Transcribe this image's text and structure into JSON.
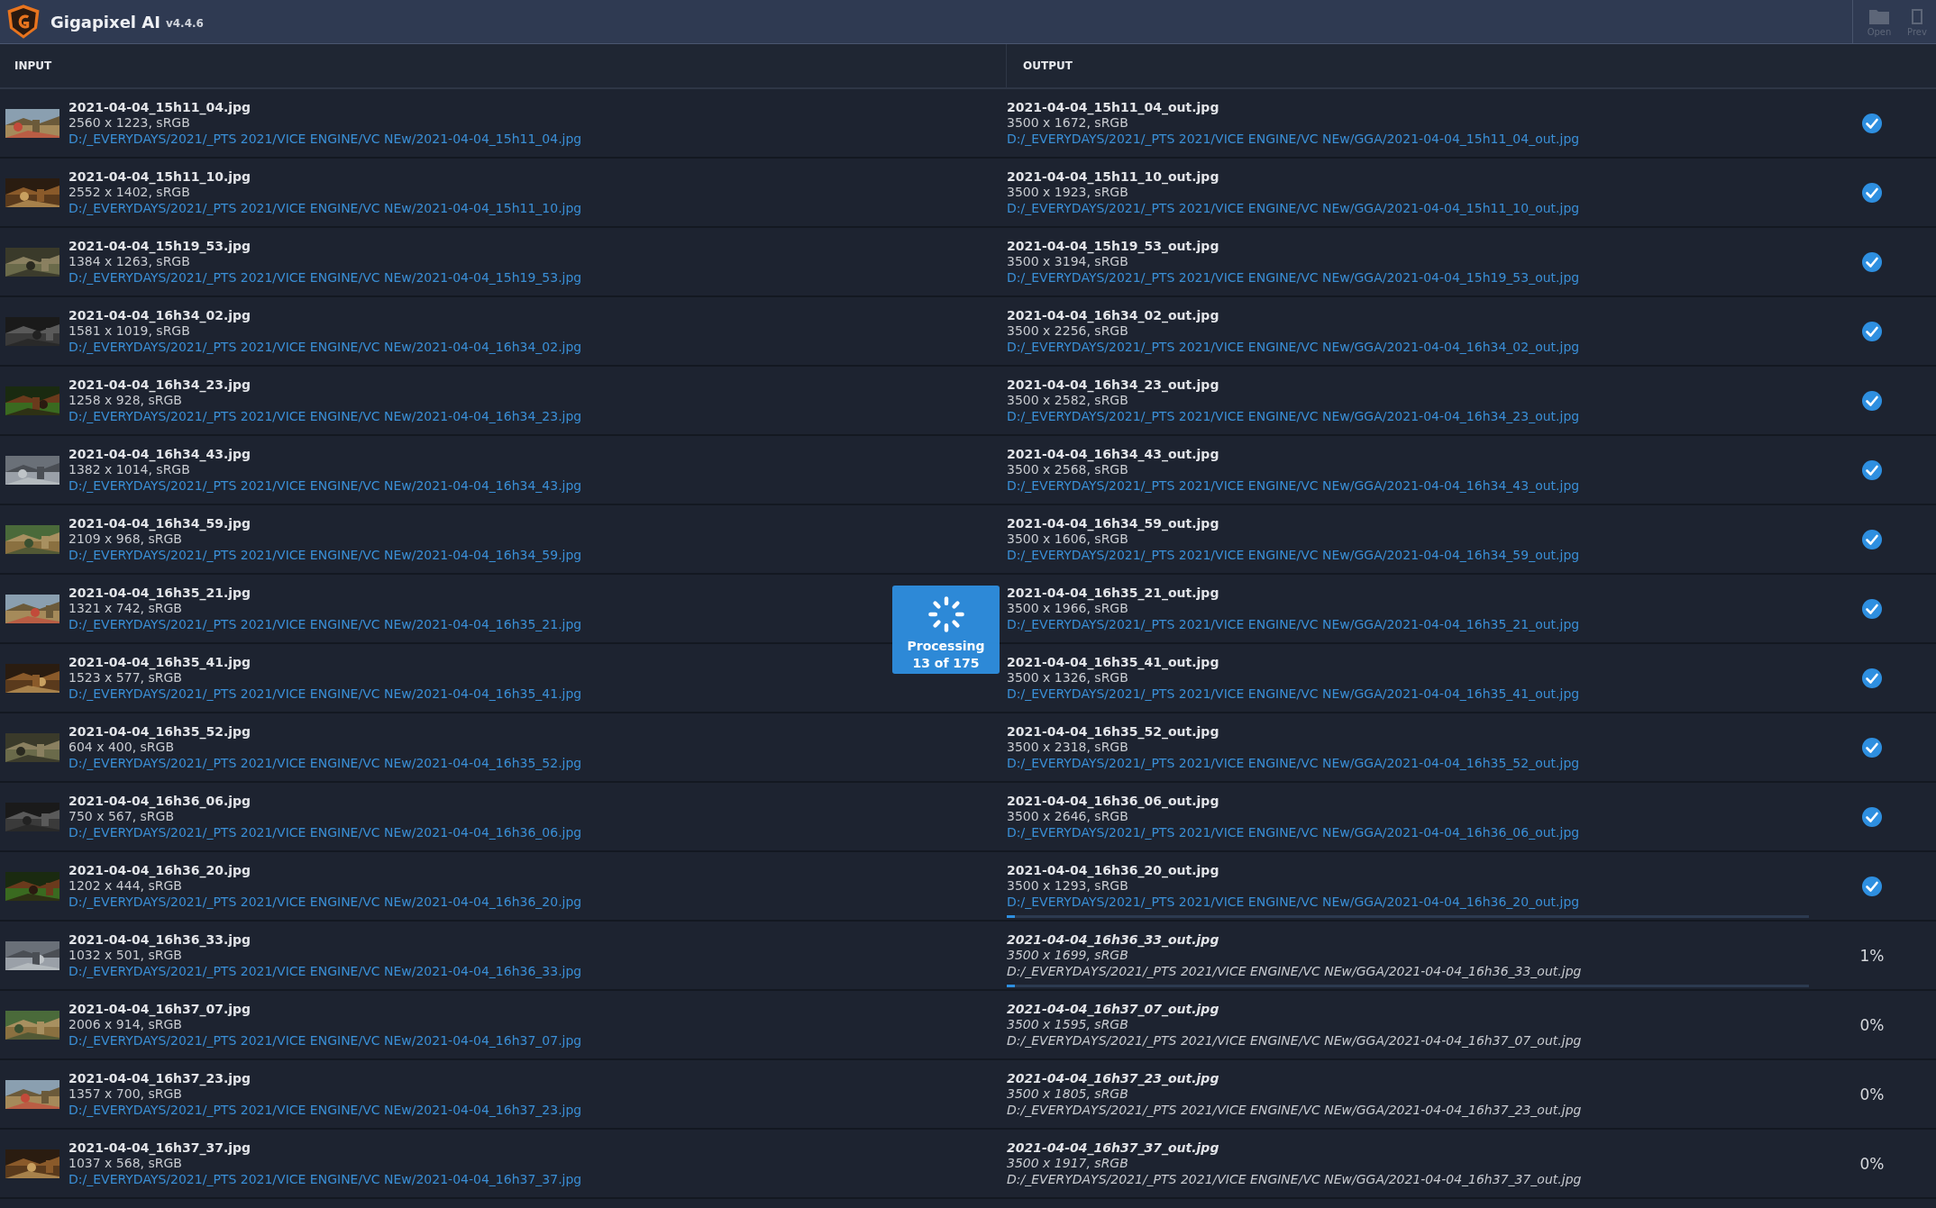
{
  "window": {
    "title": "Gigapixel AI",
    "version": "v4.4.6"
  },
  "toolbar": [
    {
      "label": "Open",
      "kind": "folder"
    },
    {
      "label": "Prev",
      "kind": "preview"
    }
  ],
  "columns": [
    "INPUT",
    "OUTPUT"
  ],
  "processing": {
    "label": "Processing",
    "count": "13 of 175"
  },
  "rows": [
    {
      "input": {
        "name": "2021-04-04_15h11_04.jpg",
        "info": "2560 x 1223, sRGB",
        "path": "D:/_EVERYDAYS/2021/_PTS 2021/VICE ENGINE/VC NEw/2021-04-04_15h11_04.jpg"
      },
      "output": {
        "name": "2021-04-04_15h11_04_out.jpg",
        "info": "3500 x 1672, sRGB",
        "path": "D:/_EVERYDAYS/2021/_PTS 2021/VICE ENGINE/VC NEw/GGA/2021-04-04_15h11_04_out.jpg"
      },
      "done": true
    },
    {
      "input": {
        "name": "2021-04-04_15h11_10.jpg",
        "info": "2552 x 1402, sRGB",
        "path": "D:/_EVERYDAYS/2021/_PTS 2021/VICE ENGINE/VC NEw/2021-04-04_15h11_10.jpg"
      },
      "output": {
        "name": "2021-04-04_15h11_10_out.jpg",
        "info": "3500 x 1923, sRGB",
        "path": "D:/_EVERYDAYS/2021/_PTS 2021/VICE ENGINE/VC NEw/GGA/2021-04-04_15h11_10_out.jpg"
      },
      "done": true
    },
    {
      "input": {
        "name": "2021-04-04_15h19_53.jpg",
        "info": "1384 x 1263, sRGB",
        "path": "D:/_EVERYDAYS/2021/_PTS 2021/VICE ENGINE/VC NEw/2021-04-04_15h19_53.jpg"
      },
      "output": {
        "name": "2021-04-04_15h19_53_out.jpg",
        "info": "3500 x 3194, sRGB",
        "path": "D:/_EVERYDAYS/2021/_PTS 2021/VICE ENGINE/VC NEw/GGA/2021-04-04_15h19_53_out.jpg"
      },
      "done": true
    },
    {
      "input": {
        "name": "2021-04-04_16h34_02.jpg",
        "info": "1581 x 1019, sRGB",
        "path": "D:/_EVERYDAYS/2021/_PTS 2021/VICE ENGINE/VC NEw/2021-04-04_16h34_02.jpg"
      },
      "output": {
        "name": "2021-04-04_16h34_02_out.jpg",
        "info": "3500 x 2256, sRGB",
        "path": "D:/_EVERYDAYS/2021/_PTS 2021/VICE ENGINE/VC NEw/GGA/2021-04-04_16h34_02_out.jpg"
      },
      "done": true
    },
    {
      "input": {
        "name": "2021-04-04_16h34_23.jpg",
        "info": "1258 x 928, sRGB",
        "path": "D:/_EVERYDAYS/2021/_PTS 2021/VICE ENGINE/VC NEw/2021-04-04_16h34_23.jpg"
      },
      "output": {
        "name": "2021-04-04_16h34_23_out.jpg",
        "info": "3500 x 2582, sRGB",
        "path": "D:/_EVERYDAYS/2021/_PTS 2021/VICE ENGINE/VC NEw/GGA/2021-04-04_16h34_23_out.jpg"
      },
      "done": true
    },
    {
      "input": {
        "name": "2021-04-04_16h34_43.jpg",
        "info": "1382 x 1014, sRGB",
        "path": "D:/_EVERYDAYS/2021/_PTS 2021/VICE ENGINE/VC NEw/2021-04-04_16h34_43.jpg"
      },
      "output": {
        "name": "2021-04-04_16h34_43_out.jpg",
        "info": "3500 x 2568, sRGB",
        "path": "D:/_EVERYDAYS/2021/_PTS 2021/VICE ENGINE/VC NEw/GGA/2021-04-04_16h34_43_out.jpg"
      },
      "done": true
    },
    {
      "input": {
        "name": "2021-04-04_16h34_59.jpg",
        "info": "2109 x 968, sRGB",
        "path": "D:/_EVERYDAYS/2021/_PTS 2021/VICE ENGINE/VC NEw/2021-04-04_16h34_59.jpg"
      },
      "output": {
        "name": "2021-04-04_16h34_59_out.jpg",
        "info": "3500 x 1606, sRGB",
        "path": "D:/_EVERYDAYS/2021/_PTS 2021/VICE ENGINE/VC NEw/GGA/2021-04-04_16h34_59_out.jpg"
      },
      "done": true
    },
    {
      "input": {
        "name": "2021-04-04_16h35_21.jpg",
        "info": "1321 x 742, sRGB",
        "path": "D:/_EVERYDAYS/2021/_PTS 2021/VICE ENGINE/VC NEw/2021-04-04_16h35_21.jpg"
      },
      "output": {
        "name": "2021-04-04_16h35_21_out.jpg",
        "info": "3500 x 1966, sRGB",
        "path": "D:/_EVERYDAYS/2021/_PTS 2021/VICE ENGINE/VC NEw/GGA/2021-04-04_16h35_21_out.jpg"
      },
      "done": true
    },
    {
      "input": {
        "name": "2021-04-04_16h35_41.jpg",
        "info": "1523 x 577, sRGB",
        "path": "D:/_EVERYDAYS/2021/_PTS 2021/VICE ENGINE/VC NEw/2021-04-04_16h35_41.jpg"
      },
      "output": {
        "name": "2021-04-04_16h35_41_out.jpg",
        "info": "3500 x 1326, sRGB",
        "path": "D:/_EVERYDAYS/2021/_PTS 2021/VICE ENGINE/VC NEw/GGA/2021-04-04_16h35_41_out.jpg"
      },
      "done": true
    },
    {
      "input": {
        "name": "2021-04-04_16h35_52.jpg",
        "info": "604 x 400, sRGB",
        "path": "D:/_EVERYDAYS/2021/_PTS 2021/VICE ENGINE/VC NEw/2021-04-04_16h35_52.jpg"
      },
      "output": {
        "name": "2021-04-04_16h35_52_out.jpg",
        "info": "3500 x 2318, sRGB",
        "path": "D:/_EVERYDAYS/2021/_PTS 2021/VICE ENGINE/VC NEw/GGA/2021-04-04_16h35_52_out.jpg"
      },
      "done": true
    },
    {
      "input": {
        "name": "2021-04-04_16h36_06.jpg",
        "info": "750 x 567, sRGB",
        "path": "D:/_EVERYDAYS/2021/_PTS 2021/VICE ENGINE/VC NEw/2021-04-04_16h36_06.jpg"
      },
      "output": {
        "name": "2021-04-04_16h36_06_out.jpg",
        "info": "3500 x 2646, sRGB",
        "path": "D:/_EVERYDAYS/2021/_PTS 2021/VICE ENGINE/VC NEw/GGA/2021-04-04_16h36_06_out.jpg"
      },
      "done": true
    },
    {
      "input": {
        "name": "2021-04-04_16h36_20.jpg",
        "info": "1202 x 444, sRGB",
        "path": "D:/_EVERYDAYS/2021/_PTS 2021/VICE ENGINE/VC NEw/2021-04-04_16h36_20.jpg"
      },
      "output": {
        "name": "2021-04-04_16h36_20_out.jpg",
        "info": "3500 x 1293, sRGB",
        "path": "D:/_EVERYDAYS/2021/_PTS 2021/VICE ENGINE/VC NEw/GGA/2021-04-04_16h36_20_out.jpg"
      },
      "done": true,
      "level": 0.01
    },
    {
      "input": {
        "name": "2021-04-04_16h36_33.jpg",
        "info": "1032 x 501, sRGB",
        "path": "D:/_EVERYDAYS/2021/_PTS 2021/VICE ENGINE/VC NEw/2021-04-04_16h36_33.jpg"
      },
      "output": {
        "name": "2021-04-04_16h36_33_out.jpg",
        "info": "3500 x 1699, sRGB",
        "path": "D:/_EVERYDAYS/2021/_PTS 2021/VICE ENGINE/VC NEw/GGA/2021-04-04_16h36_33_out.jpg"
      },
      "done": false,
      "percent": "1%",
      "level": 0.01
    },
    {
      "input": {
        "name": "2021-04-04_16h37_07.jpg",
        "info": "2006 x 914, sRGB",
        "path": "D:/_EVERYDAYS/2021/_PTS 2021/VICE ENGINE/VC NEw/2021-04-04_16h37_07.jpg"
      },
      "output": {
        "name": "2021-04-04_16h37_07_out.jpg",
        "info": "3500 x 1595, sRGB",
        "path": "D:/_EVERYDAYS/2021/_PTS 2021/VICE ENGINE/VC NEw/GGA/2021-04-04_16h37_07_out.jpg"
      },
      "done": false,
      "percent": "0%"
    },
    {
      "input": {
        "name": "2021-04-04_16h37_23.jpg",
        "info": "1357 x 700, sRGB",
        "path": "D:/_EVERYDAYS/2021/_PTS 2021/VICE ENGINE/VC NEw/2021-04-04_16h37_23.jpg"
      },
      "output": {
        "name": "2021-04-04_16h37_23_out.jpg",
        "info": "3500 x 1805, sRGB",
        "path": "D:/_EVERYDAYS/2021/_PTS 2021/VICE ENGINE/VC NEw/GGA/2021-04-04_16h37_23_out.jpg"
      },
      "done": false,
      "percent": "0%"
    },
    {
      "input": {
        "name": "2021-04-04_16h37_37.jpg",
        "info": "1037 x 568, sRGB",
        "path": "D:/_EVERYDAYS/2021/_PTS 2021/VICE ENGINE/VC NEw/2021-04-04_16h37_37.jpg"
      },
      "output": {
        "name": "2021-04-04_16h37_37_out.jpg",
        "info": "3500 x 1917, sRGB",
        "path": "D:/_EVERYDAYS/2021/_PTS 2021/VICE ENGINE/VC NEw/GGA/2021-04-04_16h37_37_out.jpg"
      },
      "done": false,
      "percent": "0%"
    }
  ]
}
